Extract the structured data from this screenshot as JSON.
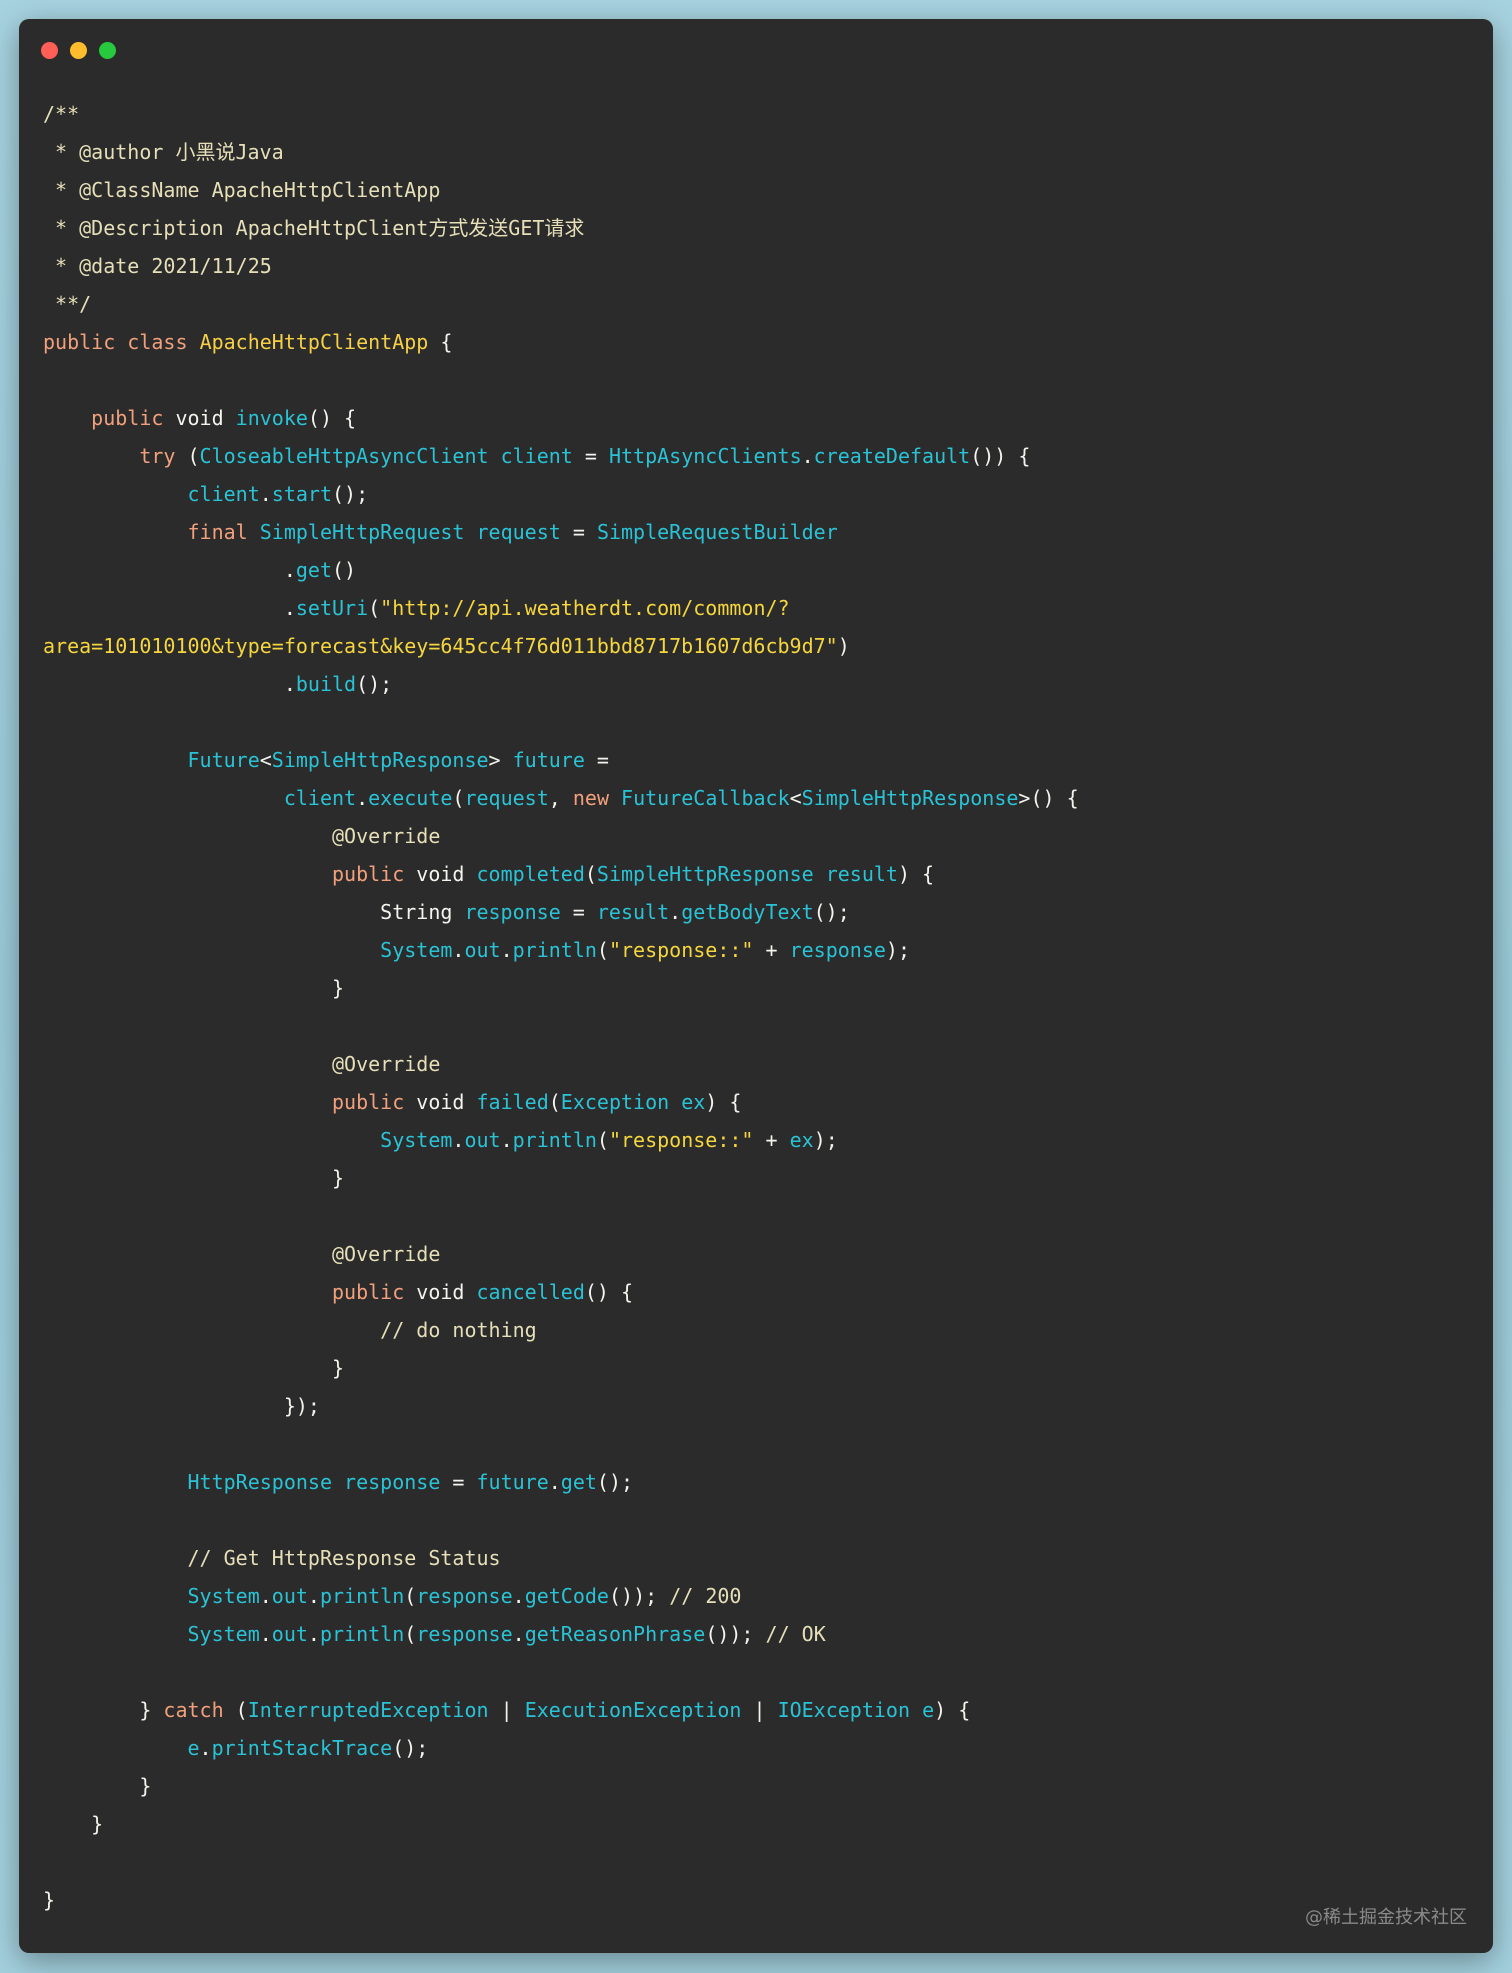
{
  "window": {
    "traffic_lights": [
      {
        "name": "close",
        "color": "#ff5f56"
      },
      {
        "name": "minimize",
        "color": "#ffbd2e"
      },
      {
        "name": "maximize",
        "color": "#27c93f"
      }
    ]
  },
  "colors": {
    "background": "#2b2b2b",
    "comment": "#e6dfb8",
    "keyword": "#f2a07c",
    "class_name": "#f7d046",
    "identifier": "#2ac3d6",
    "string": "#f5d63e",
    "plain": "#f4f4ee"
  },
  "code_lines": [
    [
      [
        "comment",
        "/**"
      ]
    ],
    [
      [
        "comment",
        " * @author 小黑说Java"
      ]
    ],
    [
      [
        "comment",
        " * @ClassName ApacheHttpClientApp"
      ]
    ],
    [
      [
        "comment",
        " * @Description ApacheHttpClient方式发送GET请求"
      ]
    ],
    [
      [
        "comment",
        " * @date 2021/11/25"
      ]
    ],
    [
      [
        "comment",
        " **/"
      ]
    ],
    [
      [
        "keyword",
        "public"
      ],
      [
        "plain",
        " "
      ],
      [
        "keyword",
        "class"
      ],
      [
        "plain",
        " "
      ],
      [
        "classdef",
        "ApacheHttpClientApp"
      ],
      [
        "plain",
        " {"
      ]
    ],
    [],
    [
      [
        "plain",
        "    "
      ],
      [
        "keyword",
        "public"
      ],
      [
        "plain",
        " void "
      ],
      [
        "ident",
        "invoke"
      ],
      [
        "plain",
        "() {"
      ]
    ],
    [
      [
        "plain",
        "        "
      ],
      [
        "keyword",
        "try"
      ],
      [
        "plain",
        " ("
      ],
      [
        "ident",
        "CloseableHttpAsyncClient"
      ],
      [
        "plain",
        " "
      ],
      [
        "ident",
        "client"
      ],
      [
        "plain",
        " = "
      ],
      [
        "ident",
        "HttpAsyncClients"
      ],
      [
        "plain",
        "."
      ],
      [
        "ident",
        "createDefault"
      ],
      [
        "plain",
        "()) {"
      ]
    ],
    [
      [
        "plain",
        "            "
      ],
      [
        "ident",
        "client"
      ],
      [
        "plain",
        "."
      ],
      [
        "ident",
        "start"
      ],
      [
        "plain",
        "();"
      ]
    ],
    [
      [
        "plain",
        "            "
      ],
      [
        "keyword",
        "final"
      ],
      [
        "plain",
        " "
      ],
      [
        "ident",
        "SimpleHttpRequest"
      ],
      [
        "plain",
        " "
      ],
      [
        "ident",
        "request"
      ],
      [
        "plain",
        " = "
      ],
      [
        "ident",
        "SimpleRequestBuilder"
      ]
    ],
    [
      [
        "plain",
        "                    ."
      ],
      [
        "ident",
        "get"
      ],
      [
        "plain",
        "()"
      ]
    ],
    [
      [
        "plain",
        "                    ."
      ],
      [
        "ident",
        "setUri"
      ],
      [
        "plain",
        "("
      ],
      [
        "string",
        "\"http://api.weatherdt.com/common/?"
      ]
    ],
    [
      [
        "string",
        "area=101010100&type=forecast&key=645cc4f76d011bbd8717b1607d6cb9d7\""
      ],
      [
        "plain",
        ")"
      ]
    ],
    [
      [
        "plain",
        "                    ."
      ],
      [
        "ident",
        "build"
      ],
      [
        "plain",
        "();"
      ]
    ],
    [],
    [
      [
        "plain",
        "            "
      ],
      [
        "ident",
        "Future"
      ],
      [
        "plain",
        "<"
      ],
      [
        "ident",
        "SimpleHttpResponse"
      ],
      [
        "plain",
        "> "
      ],
      [
        "ident",
        "future"
      ],
      [
        "plain",
        " ="
      ]
    ],
    [
      [
        "plain",
        "                    "
      ],
      [
        "ident",
        "client"
      ],
      [
        "plain",
        "."
      ],
      [
        "ident",
        "execute"
      ],
      [
        "plain",
        "("
      ],
      [
        "ident",
        "request"
      ],
      [
        "plain",
        ", "
      ],
      [
        "keyword",
        "new"
      ],
      [
        "plain",
        " "
      ],
      [
        "ident",
        "FutureCallback"
      ],
      [
        "plain",
        "<"
      ],
      [
        "ident",
        "SimpleHttpResponse"
      ],
      [
        "plain",
        ">() {"
      ]
    ],
    [
      [
        "plain",
        "                        "
      ],
      [
        "comment",
        "@Override"
      ]
    ],
    [
      [
        "plain",
        "                        "
      ],
      [
        "keyword",
        "public"
      ],
      [
        "plain",
        " void "
      ],
      [
        "ident",
        "completed"
      ],
      [
        "plain",
        "("
      ],
      [
        "ident",
        "SimpleHttpResponse"
      ],
      [
        "plain",
        " "
      ],
      [
        "ident",
        "result"
      ],
      [
        "plain",
        ") {"
      ]
    ],
    [
      [
        "plain",
        "                            String "
      ],
      [
        "ident",
        "response"
      ],
      [
        "plain",
        " = "
      ],
      [
        "ident",
        "result"
      ],
      [
        "plain",
        "."
      ],
      [
        "ident",
        "getBodyText"
      ],
      [
        "plain",
        "();"
      ]
    ],
    [
      [
        "plain",
        "                            "
      ],
      [
        "ident",
        "System"
      ],
      [
        "plain",
        "."
      ],
      [
        "ident",
        "out"
      ],
      [
        "plain",
        "."
      ],
      [
        "ident",
        "println"
      ],
      [
        "plain",
        "("
      ],
      [
        "string",
        "\"response::\""
      ],
      [
        "plain",
        " + "
      ],
      [
        "ident",
        "response"
      ],
      [
        "plain",
        ");"
      ]
    ],
    [
      [
        "plain",
        "                        }"
      ]
    ],
    [],
    [
      [
        "plain",
        "                        "
      ],
      [
        "comment",
        "@Override"
      ]
    ],
    [
      [
        "plain",
        "                        "
      ],
      [
        "keyword",
        "public"
      ],
      [
        "plain",
        " void "
      ],
      [
        "ident",
        "failed"
      ],
      [
        "plain",
        "("
      ],
      [
        "ident",
        "Exception"
      ],
      [
        "plain",
        " "
      ],
      [
        "ident",
        "ex"
      ],
      [
        "plain",
        ") {"
      ]
    ],
    [
      [
        "plain",
        "                            "
      ],
      [
        "ident",
        "System"
      ],
      [
        "plain",
        "."
      ],
      [
        "ident",
        "out"
      ],
      [
        "plain",
        "."
      ],
      [
        "ident",
        "println"
      ],
      [
        "plain",
        "("
      ],
      [
        "string",
        "\"response::\""
      ],
      [
        "plain",
        " + "
      ],
      [
        "ident",
        "ex"
      ],
      [
        "plain",
        ");"
      ]
    ],
    [
      [
        "plain",
        "                        }"
      ]
    ],
    [],
    [
      [
        "plain",
        "                        "
      ],
      [
        "comment",
        "@Override"
      ]
    ],
    [
      [
        "plain",
        "                        "
      ],
      [
        "keyword",
        "public"
      ],
      [
        "plain",
        " void "
      ],
      [
        "ident",
        "cancelled"
      ],
      [
        "plain",
        "() {"
      ]
    ],
    [
      [
        "plain",
        "                            "
      ],
      [
        "comment",
        "// do nothing"
      ]
    ],
    [
      [
        "plain",
        "                        }"
      ]
    ],
    [
      [
        "plain",
        "                    });"
      ]
    ],
    [],
    [
      [
        "plain",
        "            "
      ],
      [
        "ident",
        "HttpResponse"
      ],
      [
        "plain",
        " "
      ],
      [
        "ident",
        "response"
      ],
      [
        "plain",
        " = "
      ],
      [
        "ident",
        "future"
      ],
      [
        "plain",
        "."
      ],
      [
        "ident",
        "get"
      ],
      [
        "plain",
        "();"
      ]
    ],
    [],
    [
      [
        "plain",
        "            "
      ],
      [
        "comment",
        "// Get HttpResponse Status"
      ]
    ],
    [
      [
        "plain",
        "            "
      ],
      [
        "ident",
        "System"
      ],
      [
        "plain",
        "."
      ],
      [
        "ident",
        "out"
      ],
      [
        "plain",
        "."
      ],
      [
        "ident",
        "println"
      ],
      [
        "plain",
        "("
      ],
      [
        "ident",
        "response"
      ],
      [
        "plain",
        "."
      ],
      [
        "ident",
        "getCode"
      ],
      [
        "plain",
        "()); "
      ],
      [
        "comment",
        "// 200"
      ]
    ],
    [
      [
        "plain",
        "            "
      ],
      [
        "ident",
        "System"
      ],
      [
        "plain",
        "."
      ],
      [
        "ident",
        "out"
      ],
      [
        "plain",
        "."
      ],
      [
        "ident",
        "println"
      ],
      [
        "plain",
        "("
      ],
      [
        "ident",
        "response"
      ],
      [
        "plain",
        "."
      ],
      [
        "ident",
        "getReasonPhrase"
      ],
      [
        "plain",
        "()); "
      ],
      [
        "comment",
        "// OK"
      ]
    ],
    [],
    [
      [
        "plain",
        "        } "
      ],
      [
        "keyword",
        "catch"
      ],
      [
        "plain",
        " ("
      ],
      [
        "ident",
        "InterruptedException"
      ],
      [
        "plain",
        " | "
      ],
      [
        "ident",
        "ExecutionException"
      ],
      [
        "plain",
        " | "
      ],
      [
        "ident",
        "IOException"
      ],
      [
        "plain",
        " "
      ],
      [
        "ident",
        "e"
      ],
      [
        "plain",
        ") {"
      ]
    ],
    [
      [
        "plain",
        "            "
      ],
      [
        "ident",
        "e"
      ],
      [
        "plain",
        "."
      ],
      [
        "ident",
        "printStackTrace"
      ],
      [
        "plain",
        "();"
      ]
    ],
    [
      [
        "plain",
        "        }"
      ]
    ],
    [
      [
        "plain",
        "    }"
      ]
    ],
    [],
    [
      [
        "plain",
        "}"
      ]
    ]
  ],
  "watermark": "@稀土掘金技术社区"
}
